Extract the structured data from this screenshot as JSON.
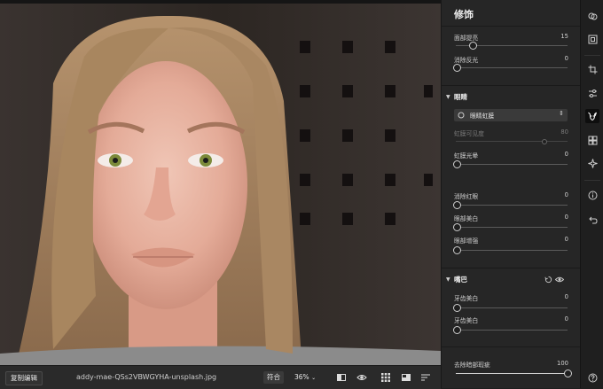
{
  "photo": {
    "alt": ""
  },
  "bottom_bar": {
    "copy_edit": "复制编辑",
    "filename": "addy-mae-QSs2VBWGYHA-unsplash.jpg",
    "fit": "符合",
    "zoom": "36%"
  },
  "panel": {
    "title": "修饰",
    "face": [
      {
        "label": "面部提亮",
        "value": "15",
        "fraction": 0.15
      },
      {
        "label": "消除反光",
        "value": "0",
        "fraction": 0.0
      }
    ],
    "eyes": {
      "title": "眼睛",
      "dropdown": "眼睛虹膜",
      "iris_visibility": {
        "label": "虹膜可见度",
        "value": "80",
        "fraction": 0.8,
        "disabled": true
      },
      "iris_flare": {
        "label": "虹膜光晕",
        "value": "0",
        "fraction": 0.0
      },
      "sliders": [
        {
          "label": "消除红眼",
          "value": "0",
          "fraction": 0.0
        },
        {
          "label": "眼部美白",
          "value": "0",
          "fraction": 0.0
        },
        {
          "label": "眼部增强",
          "value": "0",
          "fraction": 0.0
        }
      ]
    },
    "mouth": {
      "title": "嘴巴",
      "sliders": [
        {
          "label": "牙齿美白",
          "value": "0",
          "fraction": 0.0
        },
        {
          "label": "牙齿美白",
          "value": "0",
          "fraction": 0.0
        }
      ]
    },
    "teeth_remove": {
      "label": "去除暗部瑕疵",
      "value": "100",
      "fraction": 1.0
    }
  },
  "toolbar": {
    "items": [
      "layers-icon",
      "crop-frame-icon",
      "crop-icon",
      "adjust-sliders-icon",
      "face-retouch-icon",
      "grid-filter-icon",
      "sparkle-icon",
      "info-icon",
      "history-icon",
      "help-icon"
    ]
  },
  "colors": {
    "panel_bg": "#262626",
    "accent": "#cfcfcf",
    "canvas_bg": "#151515"
  }
}
